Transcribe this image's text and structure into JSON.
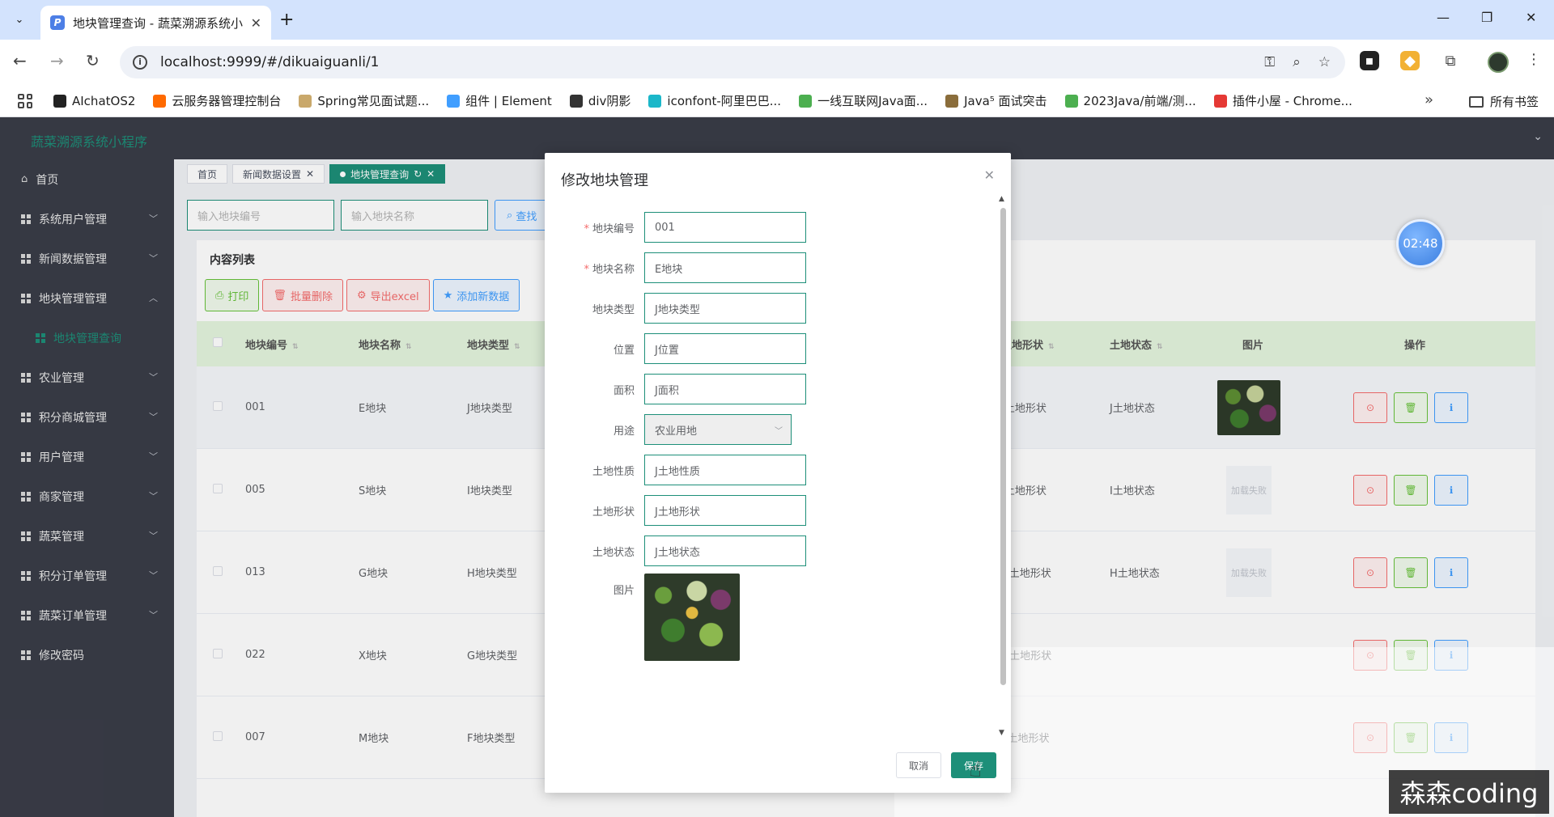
{
  "browser": {
    "tab_title": "地块管理查询 - 蔬菜溯源系统小",
    "url": "localhost:9999/#/dikuaiguanli/1",
    "bookmarks": [
      {
        "label": "AIchatOS2",
        "color": "#222"
      },
      {
        "label": "云服务器管理控制台",
        "color": "#ff6a00"
      },
      {
        "label": "Spring常见面试题...",
        "color": "#c9a86b"
      },
      {
        "label": "组件 | Element",
        "color": "#409eff"
      },
      {
        "label": "div阴影",
        "color": "#333"
      },
      {
        "label": "iconfont-阿里巴巴...",
        "color": "#1bb7c9"
      },
      {
        "label": "一线互联网Java面...",
        "color": "#4caf50"
      },
      {
        "label": "Java⁵ 面试突击",
        "color": "#8a6d3b"
      },
      {
        "label": "2023Java/前端/测...",
        "color": "#4caf50"
      },
      {
        "label": "插件小屋 - Chrome...",
        "color": "#e53935"
      }
    ],
    "bookmarks_folder": "所有书签"
  },
  "app": {
    "title": "蔬菜溯源系统小程序",
    "sidebar": {
      "home": "首页",
      "items": [
        {
          "label": "系统用户管理",
          "arrow": "down"
        },
        {
          "label": "新闻数据管理",
          "arrow": "down"
        },
        {
          "label": "地块管理管理",
          "arrow": "up"
        },
        {
          "label": "农业管理",
          "arrow": "down"
        },
        {
          "label": "积分商城管理",
          "arrow": "down"
        },
        {
          "label": "用户管理",
          "arrow": "down"
        },
        {
          "label": "商家管理",
          "arrow": "down"
        },
        {
          "label": "蔬菜管理",
          "arrow": "down"
        },
        {
          "label": "积分订单管理",
          "arrow": "down"
        },
        {
          "label": "蔬菜订单管理",
          "arrow": "down"
        }
      ],
      "sub_item": "地块管理查询",
      "last": "修改密码"
    },
    "tags": [
      "首页",
      "新闻数据设置",
      "地块管理查询"
    ],
    "search": {
      "placeholder_1": "输入地块编号",
      "placeholder_2": "输入地块名称",
      "button": "查找"
    },
    "card_title": "内容列表",
    "actions": {
      "print": "打印",
      "batch_delete": "批量删除",
      "export": "导出excel",
      "add": "添加新数据"
    },
    "table": {
      "headers": [
        "地块编号",
        "地块名称",
        "地块类型",
        "土地形状",
        "土地状态",
        "图片",
        "操作"
      ],
      "rows": [
        {
          "code": "001",
          "name": "E地块",
          "type": "J地块类型",
          "shape": "J土地形状",
          "status": "J土地状态",
          "img": "photo"
        },
        {
          "code": "005",
          "name": "S地块",
          "type": "I地块类型",
          "shape": "I土地形状",
          "status": "I土地状态",
          "img": "加载失败"
        },
        {
          "code": "013",
          "name": "G地块",
          "type": "H地块类型",
          "shape": "H土地形状",
          "status": "H土地状态",
          "img": "加载失败"
        },
        {
          "code": "022",
          "name": "X地块",
          "type": "G地块类型",
          "shape": "G土地形状",
          "status": "",
          "img": ""
        },
        {
          "code": "007",
          "name": "M地块",
          "type": "F地块类型",
          "shape": "F土地形状",
          "status": "",
          "img": ""
        }
      ]
    },
    "timer": "02:48"
  },
  "dialog": {
    "title": "修改地块管理",
    "fields": [
      {
        "label": "地块编号",
        "value": "001",
        "required": true,
        "kind": "input"
      },
      {
        "label": "地块名称",
        "value": "E地块",
        "required": true,
        "kind": "input"
      },
      {
        "label": "地块类型",
        "value": "J地块类型",
        "required": false,
        "kind": "input"
      },
      {
        "label": "位置",
        "value": "J位置",
        "required": false,
        "kind": "input"
      },
      {
        "label": "面积",
        "value": "J面积",
        "required": false,
        "kind": "input"
      },
      {
        "label": "用途",
        "value": "农业用地",
        "required": false,
        "kind": "select"
      },
      {
        "label": "土地性质",
        "value": "J土地性质",
        "required": false,
        "kind": "input"
      },
      {
        "label": "土地形状",
        "value": "J土地形状",
        "required": false,
        "kind": "input"
      },
      {
        "label": "土地状态",
        "value": "J土地状态",
        "required": false,
        "kind": "input"
      },
      {
        "label": "图片",
        "value": "",
        "required": false,
        "kind": "image"
      }
    ],
    "cancel": "取消",
    "save": "保存"
  },
  "watermark": "森森coding",
  "colors": {
    "accent": "#1d8f79",
    "header": "#3a3d48",
    "table_head": "#e4f5dd"
  }
}
